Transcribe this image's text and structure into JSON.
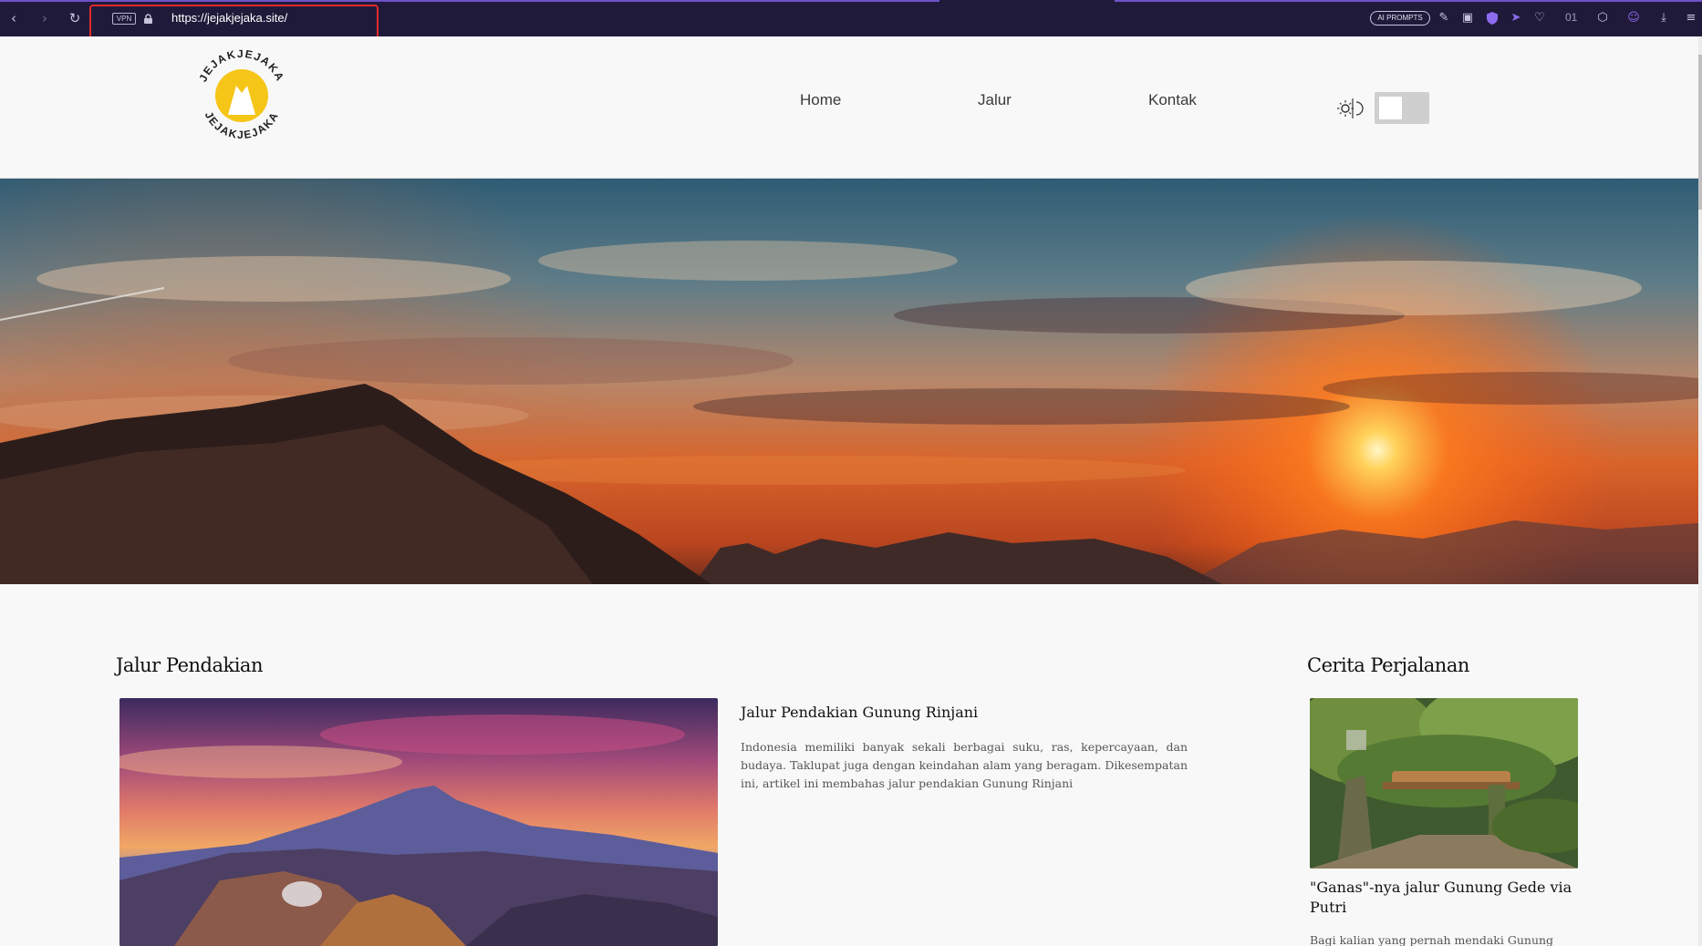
{
  "browser": {
    "vpn_label": "VPN",
    "url": "https://jejakjejaka.site/",
    "ai_prompts_label": "AI PROMPTS",
    "counter": "01",
    "icons": [
      "back-icon",
      "forward-icon",
      "reload-icon",
      "lock-icon",
      "edit-icon",
      "camera-icon",
      "shield-icon",
      "send-icon",
      "heart-icon",
      "cube-icon",
      "profile-icon",
      "download-icon",
      "menu-icon"
    ]
  },
  "site": {
    "logo_text": "JEJAKJEJAKA",
    "nav": [
      "Home",
      "Jalur",
      "Kontak"
    ],
    "theme_toggle": {
      "state": "light"
    }
  },
  "jalur": {
    "section_title": "Jalur Pendakian",
    "article": {
      "title": "Jalur Pendakian Gunung Rinjani",
      "excerpt": "Indonesia memiliki banyak sekali berbagai suku, ras, kepercayaan, dan budaya. Taklupat juga dengan keindahan alam yang beragam. Dikesempatan ini, artikel ini membahas jalur pendakian Gunung Rinjani"
    }
  },
  "cerita": {
    "section_title": "Cerita Perjalanan",
    "story": {
      "title": "\"Ganas\"-nya jalur Gunung Gede via Putri",
      "excerpt": "Bagi kalian yang pernah mendaki Gunung"
    }
  },
  "colors": {
    "chrome_bg": "#201a3a",
    "highlight": "#e12a2a",
    "logo_yellow": "#f5c518",
    "page_bg": "#f8f8f8"
  }
}
